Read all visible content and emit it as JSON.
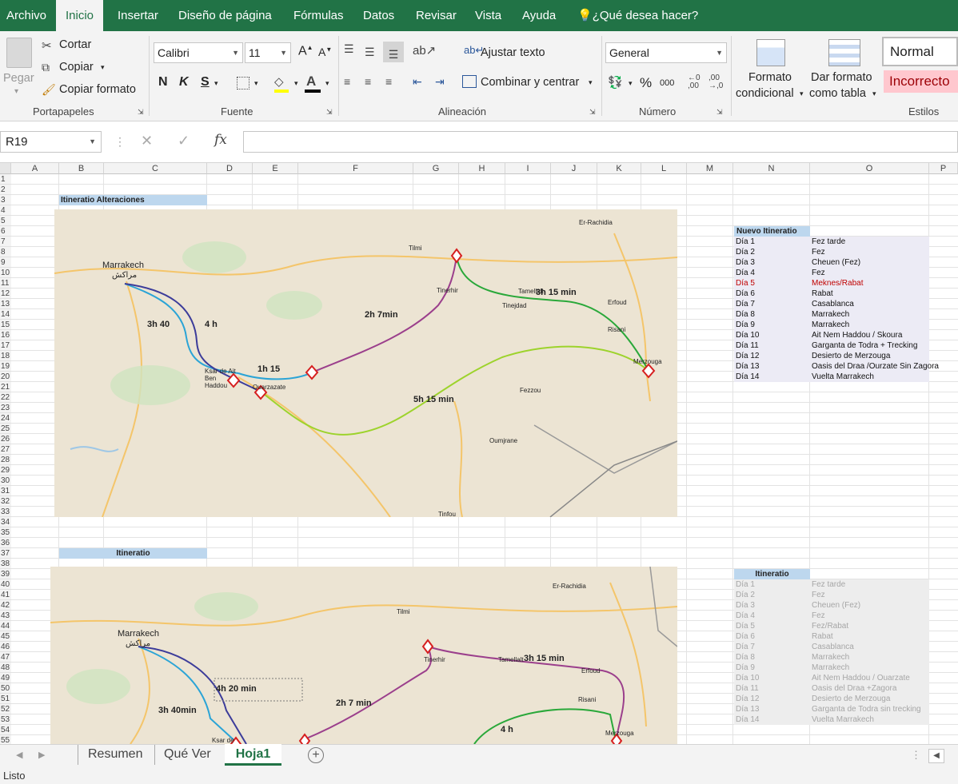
{
  "menu": {
    "archivo": "Archivo",
    "inicio": "Inicio",
    "insertar": "Insertar",
    "diseno": "Diseño de página",
    "formulas": "Fórmulas",
    "datos": "Datos",
    "revisar": "Revisar",
    "vista": "Vista",
    "ayuda": "Ayuda",
    "tell": "¿Qué desea hacer?"
  },
  "ribbon": {
    "clipboard": {
      "paste": "Pegar",
      "cut": "Cortar",
      "copy": "Copiar",
      "format_painter": "Copiar formato",
      "label": "Portapapeles"
    },
    "font": {
      "name": "Calibri",
      "size": "11",
      "bold": "N",
      "italic": "K",
      "underline": "S",
      "label": "Fuente"
    },
    "alignment": {
      "wrap": "Ajustar texto",
      "merge": "Combinar y centrar",
      "label": "Alineación"
    },
    "number": {
      "format": "General",
      "percent": "%",
      "thousands": "000",
      "label": "Número"
    },
    "styles": {
      "conditional": "Formato",
      "conditional2": "condicional",
      "table": "Dar formato",
      "table2": "como tabla",
      "normal": "Normal",
      "incorrect": "Incorrecto",
      "label": "Estilos"
    }
  },
  "formula_bar": {
    "name_box": "R19",
    "fx": "fx",
    "value": ""
  },
  "columns": [
    "A",
    "B",
    "C",
    "D",
    "E",
    "F",
    "G",
    "H",
    "I",
    "J",
    "K",
    "L",
    "M",
    "N",
    "O",
    "P"
  ],
  "rows": [
    "1",
    "2",
    "3",
    "4",
    "5",
    "6",
    "7",
    "8",
    "9",
    "10",
    "11",
    "12",
    "13",
    "14",
    "15",
    "16",
    "17",
    "18",
    "19",
    "20",
    "21",
    "22",
    "23",
    "24",
    "25",
    "26",
    "27",
    "28",
    "29",
    "30",
    "31",
    "32",
    "33",
    "34",
    "35",
    "36",
    "37",
    "38",
    "39",
    "40",
    "41",
    "42",
    "43",
    "44",
    "45",
    "46",
    "47",
    "48",
    "49",
    "50",
    "51",
    "52",
    "53",
    "54",
    "55"
  ],
  "sheet": {
    "title1": "Itineratio Alteraciones",
    "title2": "Itineratio",
    "new_header": "Nuevo Itineratio",
    "new_itinerary": [
      {
        "day": "Día 1",
        "place": "Fez tarde"
      },
      {
        "day": "Día 2",
        "place": "Fez"
      },
      {
        "day": "Día 3",
        "place": "Cheuen (Fez)"
      },
      {
        "day": "Día 4",
        "place": "Fez"
      },
      {
        "day": "Día 5",
        "place": "Meknes/Rabat"
      },
      {
        "day": "Día 6",
        "place": "Rabat"
      },
      {
        "day": "Día 7",
        "place": "Casablanca"
      },
      {
        "day": "Día 8",
        "place": "Marrakech"
      },
      {
        "day": "Día 9",
        "place": "Marrakech"
      },
      {
        "day": "Día 10",
        "place": "Ait Nem Haddou / Skoura"
      },
      {
        "day": "Día 11",
        "place": "Garganta de Todra + Trecking"
      },
      {
        "day": "Día 12",
        "place": "Desierto de Merzouga"
      },
      {
        "day": "Día 13",
        "place": "Oasis del Draa /Ourzate Sin Zagora"
      },
      {
        "day": "Día 14",
        "place": "Vuelta Marrakech"
      }
    ],
    "old_header": "Itineratio",
    "old_itinerary": [
      {
        "day": "Día 1",
        "place": "Fez tarde"
      },
      {
        "day": "Día 2",
        "place": "Fez"
      },
      {
        "day": "Día 3",
        "place": "Cheuen (Fez)"
      },
      {
        "day": "Día 4",
        "place": "Fez"
      },
      {
        "day": "Día 5",
        "place": "Fez/Rabat"
      },
      {
        "day": "Día 6",
        "place": "Rabat"
      },
      {
        "day": "Día 7",
        "place": "Casablanca"
      },
      {
        "day": "Día 8",
        "place": "Marrakech"
      },
      {
        "day": "Día 9",
        "place": "Marrakech"
      },
      {
        "day": "Día 10",
        "place": "Ait Nem Haddou / Ouarzate"
      },
      {
        "day": "Día 11",
        "place": "Oasis del Draa +Zagora"
      },
      {
        "day": "Día 12",
        "place": "Desierto de Merzouga"
      },
      {
        "day": "Día 13",
        "place": "Garganta de Todra sin trecking"
      },
      {
        "day": "Día 14",
        "place": "Vuelta Marrakech"
      }
    ]
  },
  "map1": {
    "marrakech": "Marrakech",
    "marrakech_ar": "مراكش",
    "er_rachidia": "Er-Rachidia",
    "tilmi": "Tilmi",
    "tinerhir": "Tinerhir",
    "tamellalt": "Tamellalt",
    "tinejdad": "Tinejdad",
    "erfoud": "Erfoud",
    "rissani": "Risani",
    "merzouga": "Merzouga",
    "fezzou": "Fezzou",
    "oumjrane": "Oumjrane",
    "tinfou": "Tinfou",
    "ouarzazate": "Ouarzazate",
    "ksar": "Ksar de Ait Ben Haddou",
    "t1": "3h 40",
    "t2": "4 h",
    "t3": "1h 15",
    "t4": "2h 7min",
    "t5": "3h 15 min",
    "t6": "5h 15 min"
  },
  "map2": {
    "marrakech": "Marrakech",
    "marrakech_ar": "مراكش",
    "er_rachidia": "Er-Rachidia",
    "tilmi": "Tilmi",
    "tinerhir": "Tinerhir",
    "tamellalt": "Tamellalt",
    "erfoud": "Erfoud",
    "rissani": "Risani",
    "merzouga": "Merzouga",
    "ksar": "Ksar de",
    "t1": "3h 40min",
    "t2": "4h 20 min",
    "t3": "2h 7 min",
    "t4": "3h 15 min",
    "t5": "4 h"
  },
  "tabs": [
    "Resumen",
    "Qué Ver",
    "Hoja1"
  ],
  "status": "Listo",
  "colors": {
    "excel_green": "#217346",
    "header_blue": "#bdd7ee",
    "list_bg": "#ecebf5",
    "list_bg_old": "#ededed",
    "red": "#c00000"
  }
}
